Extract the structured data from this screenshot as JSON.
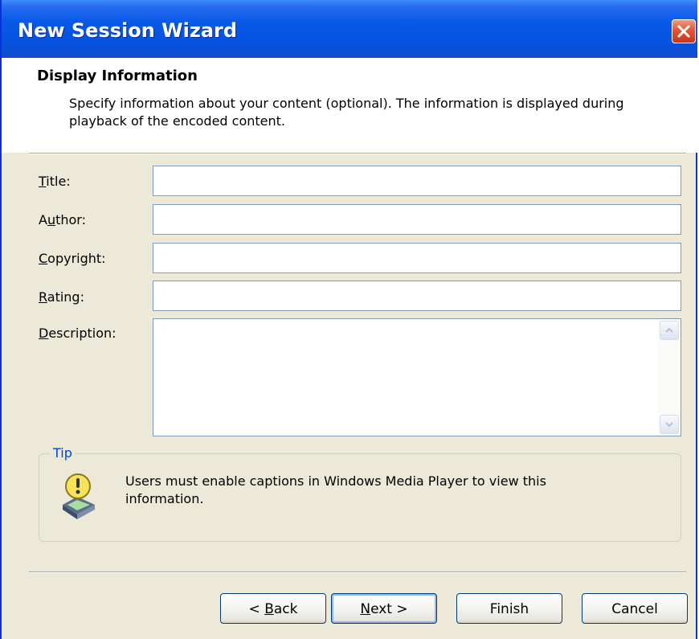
{
  "window": {
    "title": "New Session Wizard"
  },
  "header": {
    "title": "Display Information",
    "description": "Specify information about your content (optional). The information is displayed during playback of the encoded content."
  },
  "fields": [
    {
      "label": "Title:",
      "value": ""
    },
    {
      "label": "Author:",
      "value": ""
    },
    {
      "label": "Copyright:",
      "value": ""
    },
    {
      "label": "Rating:",
      "value": ""
    },
    {
      "label": "Description:",
      "value": ""
    }
  ],
  "tip": {
    "label": "Tip",
    "text": "Users must enable captions in Windows Media Player to view this information.",
    "icon": "warning-icon"
  },
  "buttons": {
    "back": "< Back",
    "next": "Next >",
    "finish": "Finish",
    "cancel": "Cancel"
  },
  "colors": {
    "titlebar": "#0553e0",
    "dialog_bg": "#ece9d8",
    "tip_label": "#0046d5"
  }
}
